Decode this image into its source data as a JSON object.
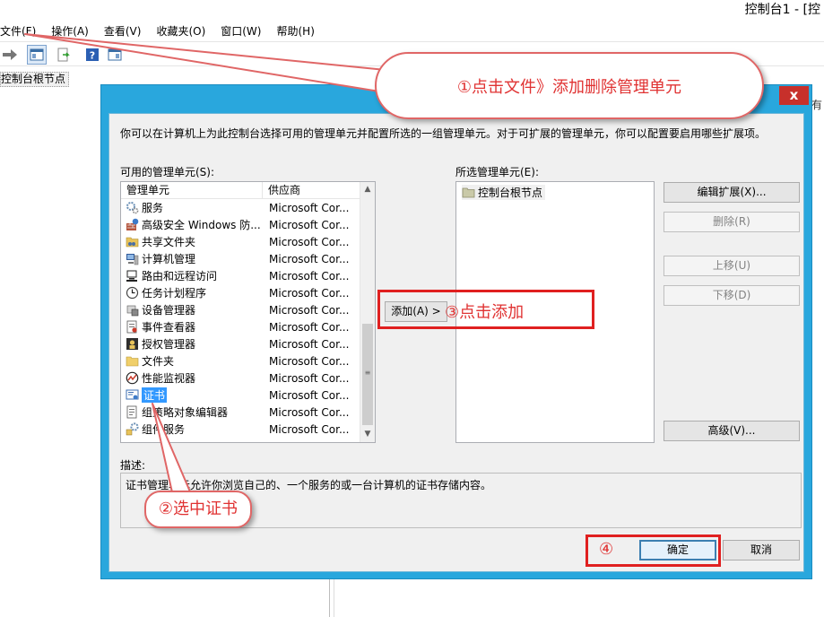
{
  "app": {
    "title": "控制台1 - [控",
    "menus": [
      "文件(F)",
      "操作(A)",
      "查看(V)",
      "收藏夹(O)",
      "窗口(W)",
      "帮助(H)"
    ],
    "tree_root": "控制台根节点",
    "peek_left": "有",
    "peek_right": "有"
  },
  "dialog": {
    "close_label": "x",
    "intro": "你可以在计算机上为此控制台选择可用的管理单元并配置所选的一组管理单元。对于可扩展的管理单元，你可以配置要启用哪些扩展项。",
    "available_label": "可用的管理单元(S):",
    "selected_label": "所选管理单元(E):",
    "columns": {
      "name": "管理单元",
      "vendor": "供应商"
    },
    "snapins": [
      {
        "name": "服务",
        "vendor": "Microsoft Cor...",
        "icon": "gears-icon"
      },
      {
        "name": "高级安全 Windows 防...",
        "vendor": "Microsoft Cor...",
        "icon": "firewall-icon"
      },
      {
        "name": "共享文件夹",
        "vendor": "Microsoft Cor...",
        "icon": "shared-folder-icon"
      },
      {
        "name": "计算机管理",
        "vendor": "Microsoft Cor...",
        "icon": "computer-management-icon"
      },
      {
        "name": "路由和远程访问",
        "vendor": "Microsoft Cor...",
        "icon": "routing-icon"
      },
      {
        "name": "任务计划程序",
        "vendor": "Microsoft Cor...",
        "icon": "clock-icon"
      },
      {
        "name": "设备管理器",
        "vendor": "Microsoft Cor...",
        "icon": "device-manager-icon"
      },
      {
        "name": "事件查看器",
        "vendor": "Microsoft Cor...",
        "icon": "event-viewer-icon"
      },
      {
        "name": "授权管理器",
        "vendor": "Microsoft Cor...",
        "icon": "authorization-icon"
      },
      {
        "name": "文件夹",
        "vendor": "Microsoft Cor...",
        "icon": "folder-icon"
      },
      {
        "name": "性能监视器",
        "vendor": "Microsoft Cor...",
        "icon": "performance-icon"
      },
      {
        "name": "证书",
        "vendor": "Microsoft Cor...",
        "icon": "certificate-icon",
        "selected": true
      },
      {
        "name": "组策略对象编辑器",
        "vendor": "Microsoft Cor...",
        "icon": "group-policy-icon"
      },
      {
        "name": "组件服务",
        "vendor": "Microsoft Cor...",
        "icon": "component-services-icon"
      }
    ],
    "selected_item": "控制台根节点",
    "buttons": {
      "add": "添加(A) >",
      "edit_extensions": "编辑扩展(X)...",
      "remove": "删除(R)",
      "move_up": "上移(U)",
      "move_down": "下移(D)",
      "advanced": "高级(V)...",
      "ok": "确定",
      "cancel": "取消"
    },
    "description_label": "描述:",
    "description": "证书管理单元允许你浏览自己的、一个服务的或一台计算机的证书存储内容。"
  },
  "annotations": {
    "step1": "①点击文件》添加删除管理单元",
    "step2": "②选中证书",
    "step3": "③点击添加",
    "step4": "④",
    "accent_color": "#e03232"
  }
}
